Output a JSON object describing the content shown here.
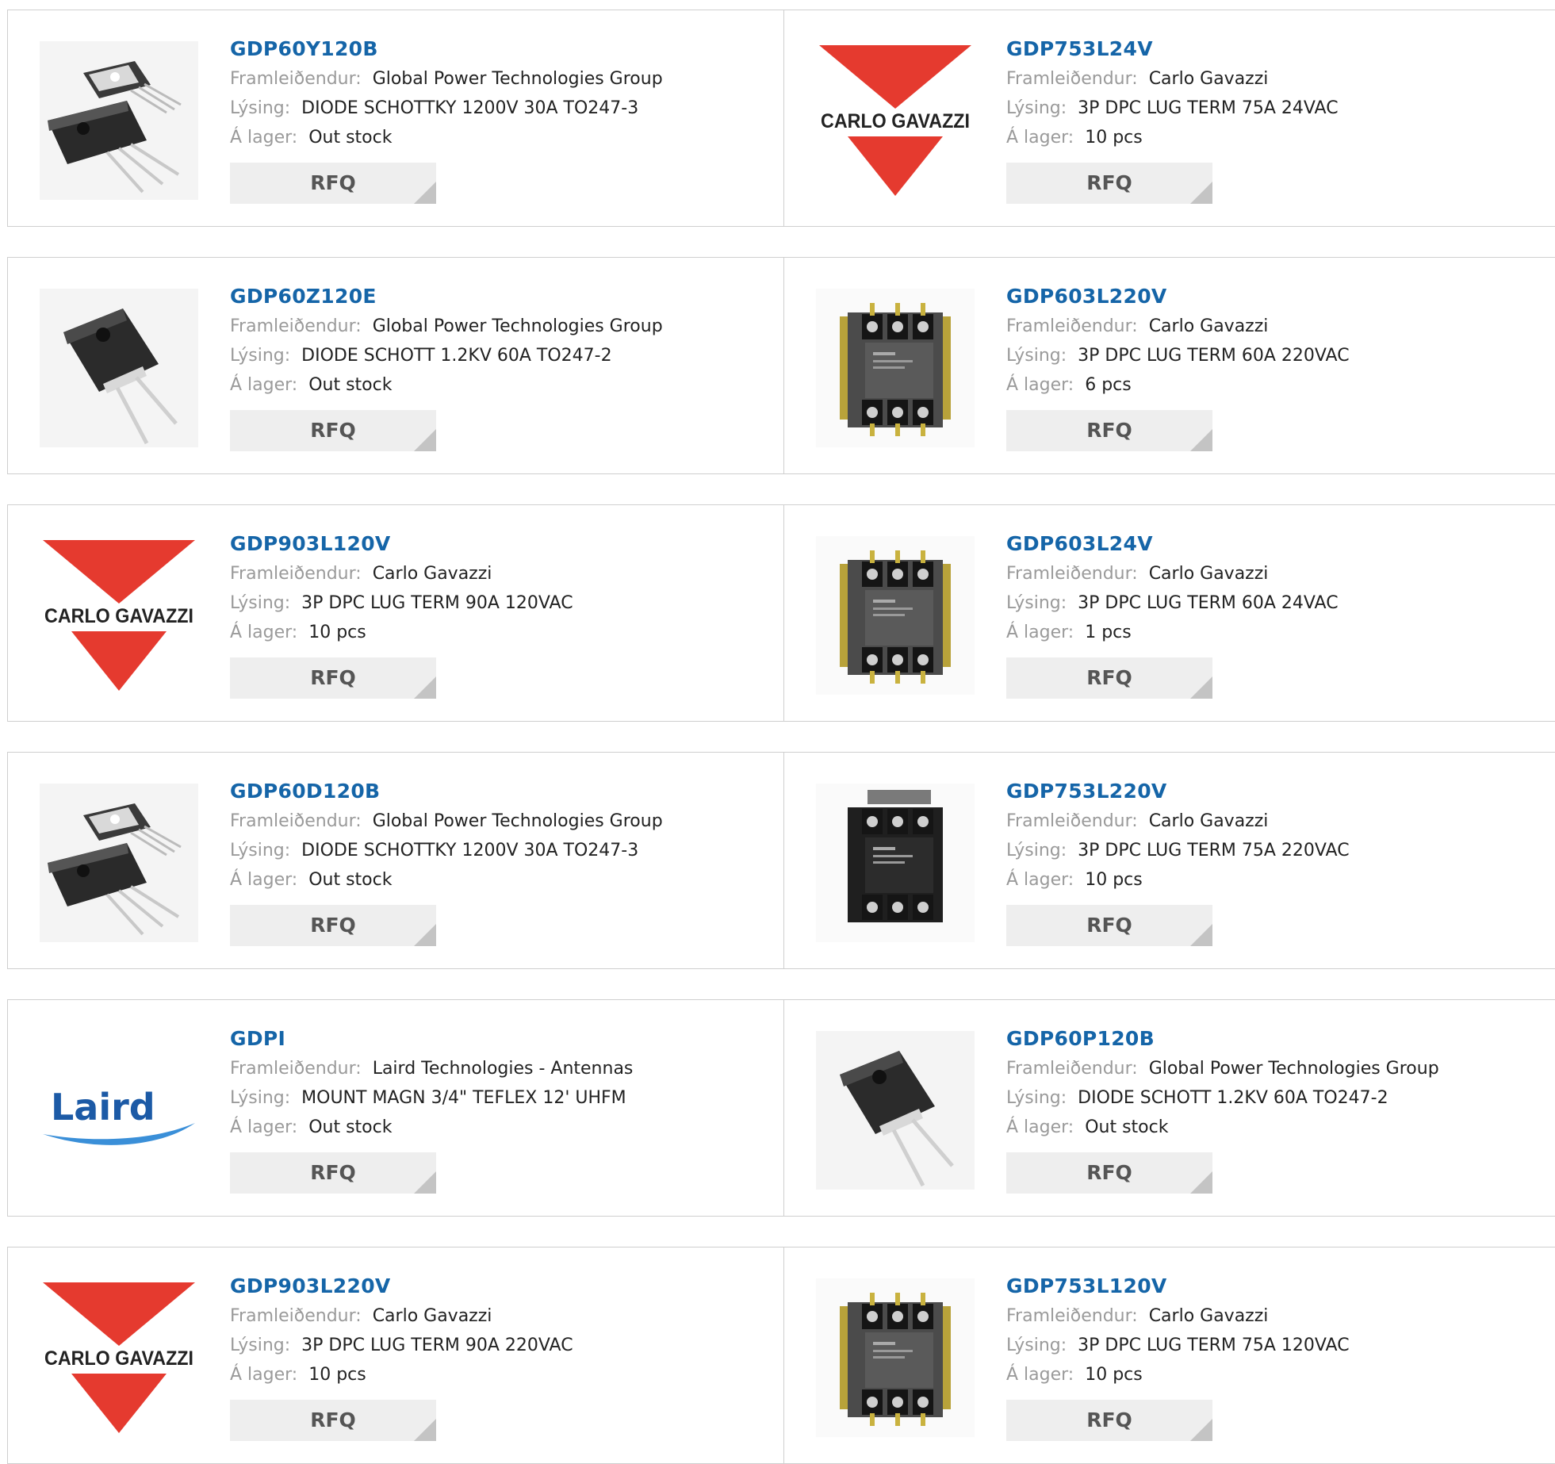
{
  "labels": {
    "manufacturer": "Framleiðendur:",
    "description": "Lýsing:",
    "stock": "Á lager:",
    "rfq": "RFQ"
  },
  "colors": {
    "part_link": "#1565a8",
    "brand_red": "#e53a2f",
    "laird_blue": "#1c5aa6"
  },
  "products": [
    {
      "part": "GDP60Y120B",
      "manufacturer": "Global Power Technologies Group",
      "description": "DIODE SCHOTTKY 1200V 30A TO247-3",
      "stock": "Out stock",
      "image": "to247-3-pair-icon"
    },
    {
      "part": "GDP753L24V",
      "manufacturer": "Carlo Gavazzi",
      "description": "3P DPC LUG TERM 75A 24VAC",
      "stock": "10 pcs",
      "image": "carlo-gavazzi-logo",
      "logo_text": "CARLO GAVAZZI"
    },
    {
      "part": "GDP60Z120E",
      "manufacturer": "Global Power Technologies Group",
      "description": "DIODE SCHOTT 1.2KV 60A TO247-2",
      "stock": "Out stock",
      "image": "to247-2-icon"
    },
    {
      "part": "GDP603L220V",
      "manufacturer": "Carlo Gavazzi",
      "description": "3P DPC LUG TERM 60A 220VAC",
      "stock": "6 pcs",
      "image": "contactor-grey-icon"
    },
    {
      "part": "GDP903L120V",
      "manufacturer": "Carlo Gavazzi",
      "description": "3P DPC LUG TERM 90A 120VAC",
      "stock": "10 pcs",
      "image": "carlo-gavazzi-logo",
      "logo_text": "CARLO GAVAZZI"
    },
    {
      "part": "GDP603L24V",
      "manufacturer": "Carlo Gavazzi",
      "description": "3P DPC LUG TERM 60A 24VAC",
      "stock": "1 pcs",
      "image": "contactor-grey-icon"
    },
    {
      "part": "GDP60D120B",
      "manufacturer": "Global Power Technologies Group",
      "description": "DIODE SCHOTTKY 1200V 30A TO247-3",
      "stock": "Out stock",
      "image": "to247-3-pair-icon"
    },
    {
      "part": "GDP753L220V",
      "manufacturer": "Carlo Gavazzi",
      "description": "3P DPC LUG TERM 75A 220VAC",
      "stock": "10 pcs",
      "image": "contactor-black-icon"
    },
    {
      "part": "GDPI",
      "manufacturer": "Laird Technologies - Antennas",
      "description": "MOUNT MAGN 3/4\" TEFLEX 12' UHFM",
      "stock": "Out stock",
      "image": "laird-logo",
      "logo_text": "Laird"
    },
    {
      "part": "GDP60P120B",
      "manufacturer": "Global Power Technologies Group",
      "description": "DIODE SCHOTT 1.2KV 60A TO247-2",
      "stock": "Out stock",
      "image": "to247-2-icon"
    },
    {
      "part": "GDP903L220V",
      "manufacturer": "Carlo Gavazzi",
      "description": "3P DPC LUG TERM 90A 220VAC",
      "stock": "10 pcs",
      "image": "carlo-gavazzi-logo",
      "logo_text": "CARLO GAVAZZI"
    },
    {
      "part": "GDP753L120V",
      "manufacturer": "Carlo Gavazzi",
      "description": "3P DPC LUG TERM 75A 120VAC",
      "stock": "10 pcs",
      "image": "contactor-grey-icon"
    }
  ]
}
